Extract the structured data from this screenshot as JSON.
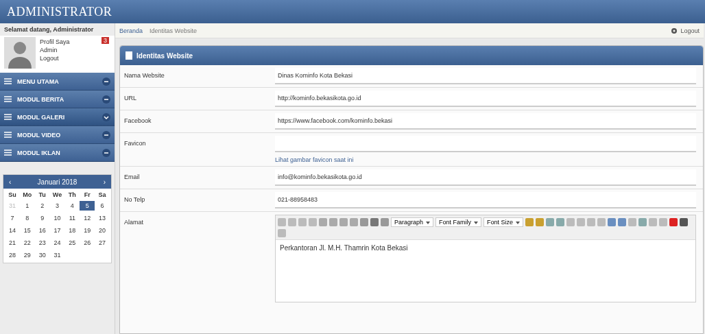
{
  "header": {
    "title": "ADMINISTRATOR"
  },
  "sidebar": {
    "greeting": "Selamat datang, Administrator",
    "user_links": [
      "Profil Saya",
      "Admin",
      "Logout"
    ],
    "badge": "3",
    "menu": [
      {
        "label": "MENU UTAMA",
        "expanded": false
      },
      {
        "label": "MODUL BERITA",
        "expanded": false
      },
      {
        "label": "MODUL GALERI",
        "expanded": true
      },
      {
        "label": "MODUL VIDEO",
        "expanded": false
      },
      {
        "label": "MODUL IKLAN",
        "expanded": false
      }
    ],
    "calendar": {
      "month": "Januari 2018",
      "prev": "‹",
      "next": "›",
      "weekdays": [
        "Su",
        "Mo",
        "Tu",
        "We",
        "Th",
        "Fr",
        "Sa"
      ],
      "weeks": [
        [
          {
            "day": "31",
            "muted": true,
            "selected": false
          },
          {
            "day": "1",
            "muted": false,
            "selected": false
          },
          {
            "day": "2",
            "muted": false,
            "selected": false
          },
          {
            "day": "3",
            "muted": false,
            "selected": false
          },
          {
            "day": "4",
            "muted": false,
            "selected": false
          },
          {
            "day": "5",
            "muted": false,
            "selected": true
          },
          {
            "day": "6",
            "muted": false,
            "selected": false
          }
        ],
        [
          {
            "day": "7",
            "muted": false,
            "selected": false
          },
          {
            "day": "8",
            "muted": false,
            "selected": false
          },
          {
            "day": "9",
            "muted": false,
            "selected": false
          },
          {
            "day": "10",
            "muted": false,
            "selected": false
          },
          {
            "day": "11",
            "muted": false,
            "selected": false
          },
          {
            "day": "12",
            "muted": false,
            "selected": false
          },
          {
            "day": "13",
            "muted": false,
            "selected": false
          }
        ],
        [
          {
            "day": "14",
            "muted": false,
            "selected": false
          },
          {
            "day": "15",
            "muted": false,
            "selected": false
          },
          {
            "day": "16",
            "muted": false,
            "selected": false
          },
          {
            "day": "17",
            "muted": false,
            "selected": false
          },
          {
            "day": "18",
            "muted": false,
            "selected": false
          },
          {
            "day": "19",
            "muted": false,
            "selected": false
          },
          {
            "day": "20",
            "muted": false,
            "selected": false
          }
        ],
        [
          {
            "day": "21",
            "muted": false,
            "selected": false
          },
          {
            "day": "22",
            "muted": false,
            "selected": false
          },
          {
            "day": "23",
            "muted": false,
            "selected": false
          },
          {
            "day": "24",
            "muted": false,
            "selected": false
          },
          {
            "day": "25",
            "muted": false,
            "selected": false
          },
          {
            "day": "26",
            "muted": false,
            "selected": false
          },
          {
            "day": "27",
            "muted": false,
            "selected": false
          }
        ],
        [
          {
            "day": "28",
            "muted": false,
            "selected": false
          },
          {
            "day": "29",
            "muted": false,
            "selected": false
          },
          {
            "day": "30",
            "muted": false,
            "selected": false
          },
          {
            "day": "31",
            "muted": false,
            "selected": false
          }
        ]
      ]
    }
  },
  "breadcrumb": [
    "Beranda",
    "Identitas Website"
  ],
  "top_right": {
    "label": "Logout"
  },
  "panel": {
    "title": "Identitas Website",
    "fields": [
      {
        "kind": "text",
        "label": "Nama Website",
        "value": "Dinas Kominfo Kota Bekasi"
      },
      {
        "kind": "text",
        "label": "URL",
        "value": "http://kominfo.bekasikota.go.id"
      },
      {
        "kind": "text",
        "label": "Facebook",
        "value": "https://www.facebook.com/kominfo.bekasi"
      },
      {
        "kind": "file",
        "label": "Favicon",
        "link": "Lihat gambar favicon saat ini"
      },
      {
        "kind": "text",
        "label": "Email",
        "value": "info@kominfo.bekasikota.go.id"
      },
      {
        "kind": "text",
        "label": "No Telp",
        "value": "021-88958483"
      },
      {
        "kind": "editor",
        "label": "Alamat",
        "toolbar": [
          "Paragraph",
          "Font Family",
          "Font Size"
        ],
        "value": "Perkantoran Jl. M.H. Thamrin Kota Bekasi"
      }
    ]
  }
}
